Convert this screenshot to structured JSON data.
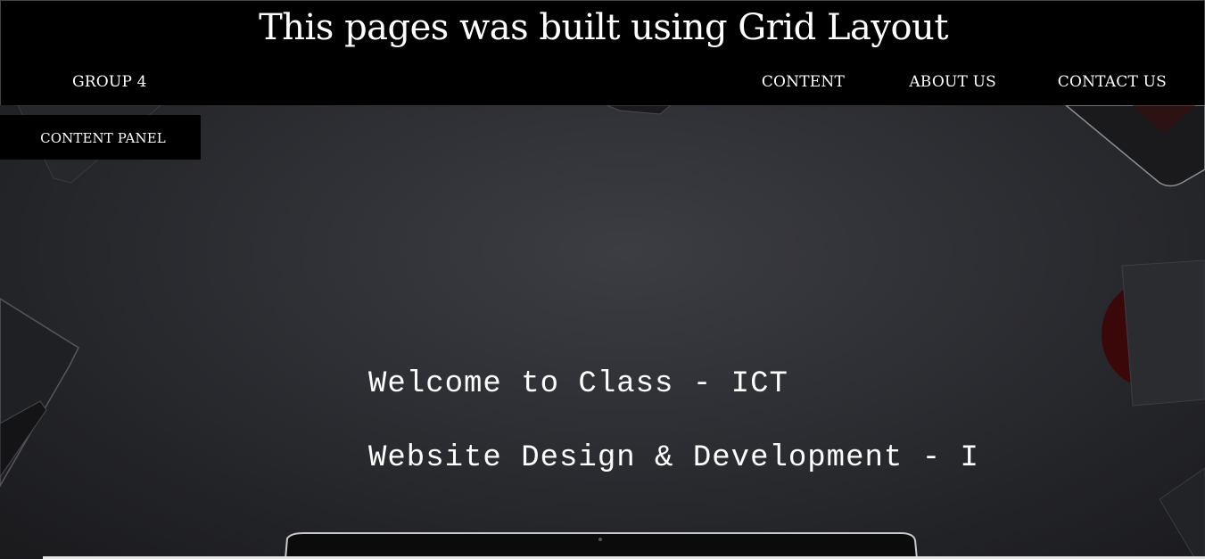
{
  "header": {
    "title": "This pages was built using Grid Layout",
    "brand": "GROUP 4"
  },
  "nav": {
    "items": [
      {
        "label": "CONTENT"
      },
      {
        "label": "ABOUT US"
      },
      {
        "label": "CONTACT US"
      }
    ]
  },
  "sidebar": {
    "panel_label": "CONTENT PANEL"
  },
  "hero": {
    "line_1": "Welcome to Class - ICT",
    "line_2": "Website Design & Development - I"
  },
  "colors": {
    "header_bg": "#000000",
    "text": "#ffffff",
    "background": "#2f3035"
  }
}
